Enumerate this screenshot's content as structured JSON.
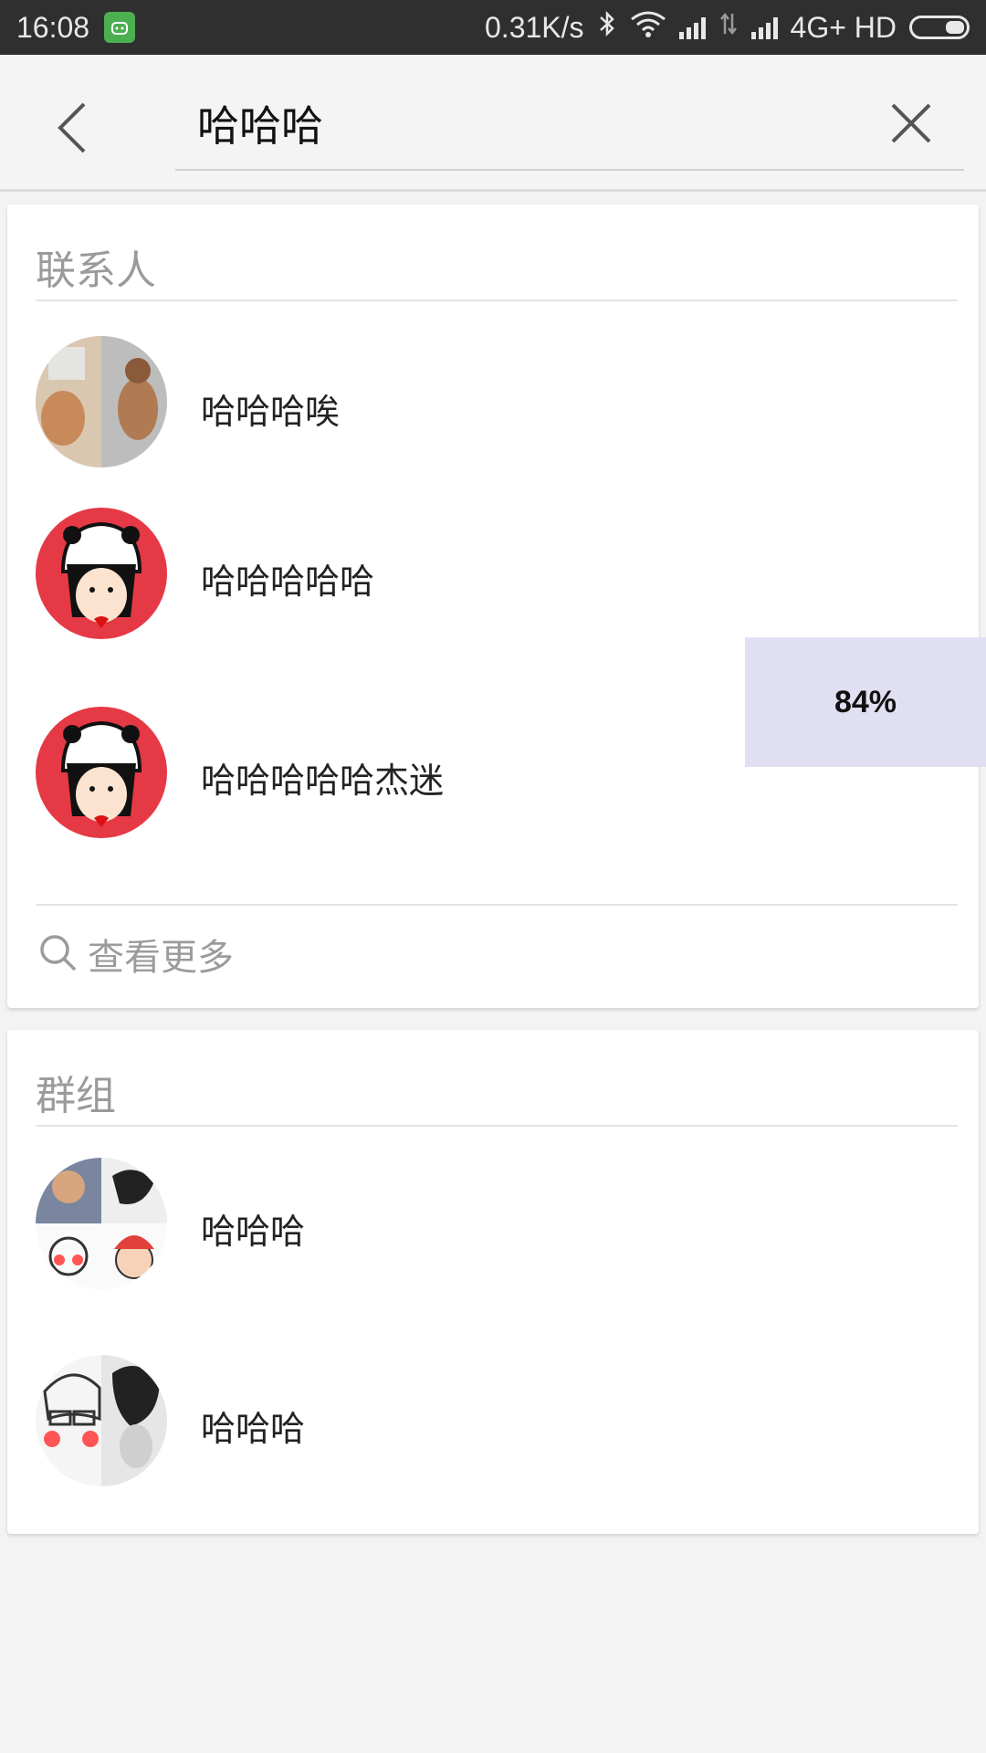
{
  "status_bar": {
    "time": "16:08",
    "net_speed": "0.31K/s",
    "network": "4G+ HD"
  },
  "search": {
    "query": "哈哈哈"
  },
  "contacts": {
    "title": "联系人",
    "items": [
      {
        "name": "哈哈哈唉"
      },
      {
        "name": "哈哈哈哈哈"
      },
      {
        "name": "哈哈哈哈哈杰迷"
      }
    ],
    "more_label": "查看更多"
  },
  "groups": {
    "title": "群组",
    "items": [
      {
        "name": "哈哈哈"
      },
      {
        "name": "哈哈哈"
      }
    ]
  },
  "progress": {
    "label": "84%",
    "value": 0.84
  },
  "colors": {
    "status_bar": "#2f2f2f",
    "background": "#f3f3f3",
    "overlay": "#e1dff2",
    "avatar_red": "#e53945"
  }
}
